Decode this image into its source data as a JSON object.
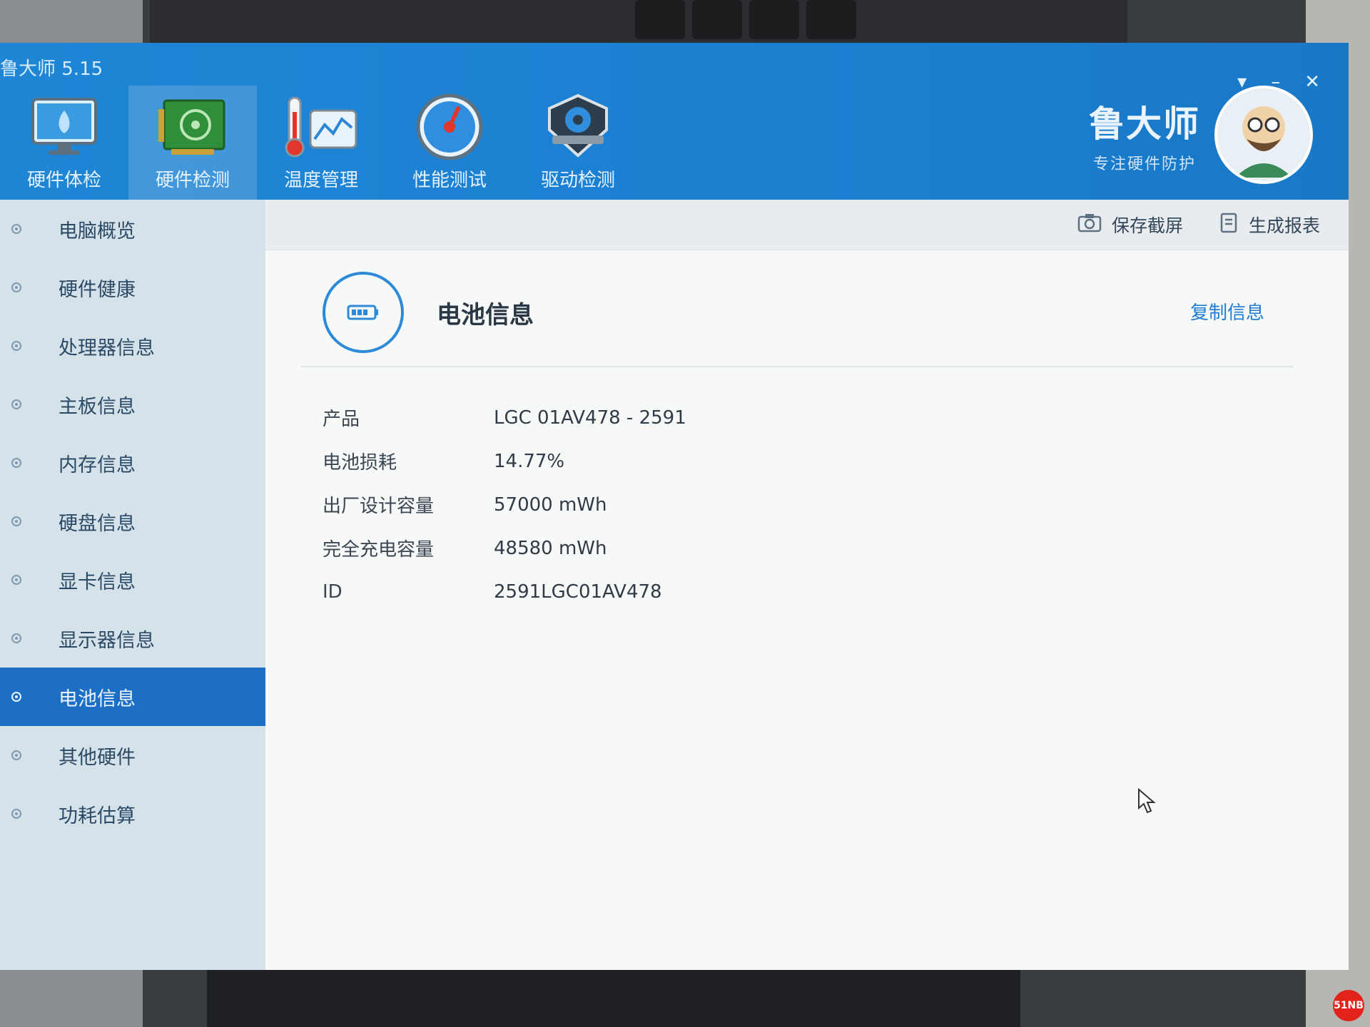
{
  "window": {
    "title": "鲁大师 5.15",
    "controls": [
      "▾",
      "–",
      "✕"
    ]
  },
  "toolbar_main": [
    {
      "label": "硬件体检",
      "icon": "monitor-icon"
    },
    {
      "label": "硬件检测",
      "icon": "circuit-board-icon",
      "active": true
    },
    {
      "label": "温度管理",
      "icon": "thermometer-chart-icon"
    },
    {
      "label": "性能测试",
      "icon": "speedometer-icon"
    },
    {
      "label": "驱动检测",
      "icon": "gear-shield-icon"
    }
  ],
  "brand": {
    "name": "鲁大师",
    "slogan": "专注硬件防护"
  },
  "sidebar": {
    "items": [
      {
        "label": "电脑概览"
      },
      {
        "label": "硬件健康"
      },
      {
        "label": "处理器信息"
      },
      {
        "label": "主板信息"
      },
      {
        "label": "内存信息"
      },
      {
        "label": "硬盘信息"
      },
      {
        "label": "显卡信息"
      },
      {
        "label": "显示器信息"
      },
      {
        "label": "电池信息",
        "active": true
      },
      {
        "label": "其他硬件"
      },
      {
        "label": "功耗估算"
      }
    ]
  },
  "actions": {
    "save_screenshot": "保存截屏",
    "generate_report": "生成报表"
  },
  "section": {
    "title": "电池信息",
    "copy_label": "复制信息",
    "rows": [
      {
        "key": "产品",
        "value": "LGC 01AV478 -  2591"
      },
      {
        "key": "电池损耗",
        "value": "14.77%"
      },
      {
        "key": "出厂设计容量",
        "value": "57000 mWh"
      },
      {
        "key": "完全充电容量",
        "value": "48580 mWh"
      },
      {
        "key": "ID",
        "value": "2591LGC01AV478"
      }
    ]
  },
  "watermark": "51NB",
  "colors": {
    "header": "#1f86d6",
    "active_sidebar": "#1d6fc6",
    "link": "#1f7dd3"
  }
}
